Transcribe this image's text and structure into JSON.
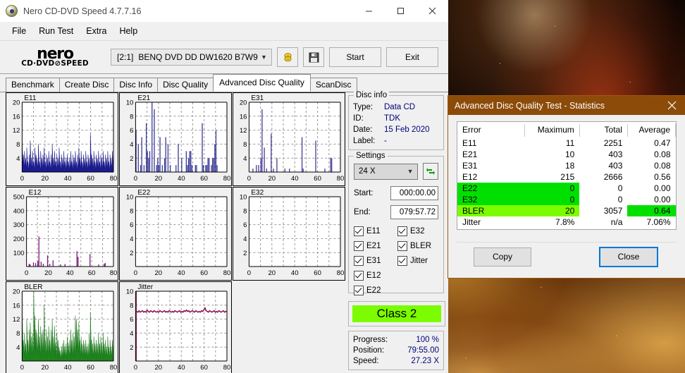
{
  "window": {
    "title": "Nero CD-DVD Speed 4.7.7.16",
    "icon": "nero-disc-icon",
    "minimize_label": "—",
    "maximize_label": "□",
    "close_label": "✕"
  },
  "menu": {
    "items": [
      "File",
      "Run Test",
      "Extra",
      "Help"
    ]
  },
  "toolbar": {
    "logo_line1": "nero",
    "logo_line2": "CD·DVD⊘SPEED",
    "drive_id": "[2:1]",
    "drive_name": "BENQ DVD DD DW1620 B7W9",
    "eject_icon": "disc-speed-icon",
    "save_icon": "floppy-save-icon",
    "start_label": "Start",
    "exit_label": "Exit"
  },
  "tabs": {
    "items": [
      "Benchmark",
      "Create Disc",
      "Disc Info",
      "Disc Quality",
      "Advanced Disc Quality",
      "ScanDisc"
    ],
    "active": "Advanced Disc Quality"
  },
  "disc_info": {
    "legend": "Disc info",
    "rows": [
      {
        "key": "Type:",
        "value": "Data CD"
      },
      {
        "key": "ID:",
        "value": "TDK"
      },
      {
        "key": "Date:",
        "value": "15 Feb 2020"
      },
      {
        "key": "Label:",
        "value": "-"
      }
    ]
  },
  "settings": {
    "legend": "Settings",
    "speed": "24 X",
    "refresh_icon": "refresh-icon",
    "start_label": "Start:",
    "start_value": "000:00.00",
    "end_label": "End:",
    "end_value": "079:57.72",
    "checkboxes_left": [
      "E11",
      "E21",
      "E31",
      "E12",
      "E22"
    ],
    "checkboxes_right": [
      "E32",
      "BLER",
      "Jitter"
    ]
  },
  "class_result": "Class 2",
  "class_color": "#7cfc00",
  "progress_panel": [
    {
      "key": "Progress:",
      "value": "100 %"
    },
    {
      "key": "Position:",
      "value": "79:55.00"
    },
    {
      "key": "Speed:",
      "value": "27.23 X"
    }
  ],
  "stats_dialog": {
    "title": "Advanced Disc Quality Test - Statistics",
    "close_icon": "close-icon",
    "headers": [
      "Error",
      "Maximum",
      "Total",
      "Average"
    ],
    "rows": [
      {
        "error": "E11",
        "maximum": "11",
        "total": "2251",
        "average": "0.47",
        "hl": "none"
      },
      {
        "error": "E21",
        "maximum": "10",
        "total": "403",
        "average": "0.08",
        "hl": "none"
      },
      {
        "error": "E31",
        "maximum": "18",
        "total": "403",
        "average": "0.08",
        "hl": "none"
      },
      {
        "error": "E12",
        "maximum": "215",
        "total": "2666",
        "average": "0.56",
        "hl": "none"
      },
      {
        "error": "E22",
        "maximum": "0",
        "total": "0",
        "average": "0.00",
        "hl": "green-left"
      },
      {
        "error": "E32",
        "maximum": "0",
        "total": "0",
        "average": "0.00",
        "hl": "green-left"
      },
      {
        "error": "BLER",
        "maximum": "20",
        "total": "3057",
        "average": "0.64",
        "hl": "lime-left-green-avg"
      },
      {
        "error": "Jitter",
        "maximum": "7.8%",
        "total": "n/a",
        "average": "7.06%",
        "hl": "none"
      }
    ],
    "copy_label": "Copy",
    "close_label": "Close"
  },
  "chart_data": [
    {
      "type": "area",
      "name": "E11",
      "title": "E11",
      "color": "#1a1a8c",
      "fill": "#1c1c90",
      "xlabel": "",
      "ylabel": "",
      "xlim": [
        0,
        80
      ],
      "ylim": [
        0,
        20
      ],
      "xticks": [
        0,
        20,
        40,
        60,
        80
      ],
      "yticks": [
        4,
        8,
        12,
        16,
        20
      ],
      "grid": true,
      "values": [
        8,
        5,
        6,
        4,
        7,
        3,
        5,
        9,
        4,
        6,
        3,
        7,
        5,
        4,
        8,
        3,
        6,
        4,
        5,
        7,
        3,
        5,
        4,
        6,
        3,
        5,
        8,
        4,
        6,
        3,
        5,
        4,
        7,
        3,
        5,
        4,
        6,
        3,
        4,
        5,
        3,
        4,
        6,
        3,
        5,
        4,
        6,
        3,
        5,
        7,
        4,
        6,
        3,
        5,
        4,
        6,
        3,
        5,
        4,
        11,
        5,
        4,
        6,
        3,
        5,
        4,
        6,
        3,
        5,
        4,
        6,
        3,
        5,
        4,
        6,
        3,
        5,
        4,
        6,
        4
      ]
    },
    {
      "type": "bar",
      "name": "E21",
      "title": "E21",
      "color": "#3a3a96",
      "xlabel": "",
      "ylabel": "",
      "xlim": [
        0,
        80
      ],
      "ylim": [
        0,
        10
      ],
      "xticks": [
        0,
        20,
        40,
        60,
        80
      ],
      "yticks": [
        2,
        4,
        6,
        8,
        10
      ],
      "grid": true,
      "values": [
        6,
        0,
        4,
        0,
        1,
        5,
        0,
        1,
        0,
        7,
        3,
        2,
        3,
        0,
        10,
        0,
        9,
        0,
        1,
        2,
        1,
        5,
        0,
        1,
        0,
        2,
        5,
        0,
        4,
        0,
        1,
        0,
        0,
        0,
        0,
        1,
        0,
        4,
        0,
        0,
        2,
        0,
        0,
        0,
        3,
        1,
        2,
        3,
        3,
        1,
        0,
        0,
        1,
        1,
        0,
        0,
        0,
        0,
        7,
        1,
        0,
        1,
        1,
        2,
        2,
        0,
        1,
        2,
        2,
        4,
        6,
        1,
        0,
        0,
        0,
        0,
        0,
        0,
        0,
        0
      ]
    },
    {
      "type": "bar",
      "name": "E31",
      "title": "E31",
      "color": "#4a3a96",
      "xlabel": "",
      "ylabel": "",
      "xlim": [
        0,
        80
      ],
      "ylim": [
        0,
        20
      ],
      "xticks": [
        0,
        20,
        40,
        60,
        80
      ],
      "yticks": [
        4,
        8,
        12,
        16,
        20
      ],
      "grid": true,
      "values": [
        0,
        0,
        0,
        1,
        0,
        0,
        2,
        0,
        2,
        0,
        4,
        18,
        0,
        7,
        0,
        1,
        0,
        0,
        0,
        11,
        0,
        1,
        0,
        0,
        4,
        0,
        0,
        0,
        0,
        0,
        0,
        1,
        0,
        0,
        0,
        1,
        0,
        0,
        0,
        0,
        0,
        0,
        0,
        0,
        0,
        0,
        10,
        1,
        0,
        0,
        0,
        0,
        0,
        0,
        0,
        0,
        0,
        0,
        9,
        0,
        0,
        0,
        0,
        0,
        0,
        0,
        1,
        0,
        0,
        0,
        0,
        4,
        4,
        0,
        0,
        0,
        0,
        0,
        0,
        0
      ]
    },
    {
      "type": "bar",
      "name": "E12",
      "title": "E12",
      "color": "#7a1b7a",
      "xlabel": "",
      "ylabel": "",
      "xlim": [
        0,
        80
      ],
      "ylim": [
        0,
        500
      ],
      "xticks": [
        0,
        20,
        40,
        60,
        80
      ],
      "yticks": [
        100,
        200,
        300,
        400,
        500
      ],
      "grid": true,
      "values": [
        0,
        0,
        20,
        15,
        0,
        0,
        30,
        0,
        25,
        0,
        40,
        215,
        0,
        35,
        0,
        20,
        0,
        0,
        0,
        80,
        0,
        20,
        0,
        0,
        45,
        0,
        0,
        0,
        0,
        0,
        0,
        15,
        0,
        0,
        0,
        18,
        0,
        0,
        0,
        0,
        0,
        0,
        0,
        0,
        0,
        0,
        110,
        70,
        0,
        0,
        0,
        0,
        0,
        0,
        0,
        0,
        0,
        0,
        90,
        0,
        0,
        0,
        0,
        0,
        0,
        0,
        15,
        0,
        0,
        0,
        0,
        20,
        25,
        0,
        0,
        0,
        0,
        0,
        0,
        0
      ]
    },
    {
      "type": "bar",
      "name": "E22",
      "title": "E22",
      "color": "#3a3a96",
      "xlabel": "",
      "ylabel": "",
      "xlim": [
        0,
        80
      ],
      "ylim": [
        0,
        10
      ],
      "xticks": [
        0,
        20,
        40,
        60,
        80
      ],
      "yticks": [
        2,
        4,
        6,
        8,
        10
      ],
      "grid": true,
      "values": []
    },
    {
      "type": "bar",
      "name": "E32",
      "title": "E32",
      "color": "#3a3a96",
      "xlabel": "",
      "ylabel": "",
      "xlim": [
        0,
        80
      ],
      "ylim": [
        0,
        10
      ],
      "xticks": [
        0,
        20,
        40,
        60,
        80
      ],
      "yticks": [
        2,
        4,
        6,
        8,
        10
      ],
      "grid": true,
      "values": []
    },
    {
      "type": "area",
      "name": "BLER",
      "title": "BLER",
      "color": "#1d7a1d",
      "fill": "#1d8c1d",
      "xlabel": "",
      "ylabel": "",
      "xlim": [
        0,
        80
      ],
      "ylim": [
        0,
        20
      ],
      "xticks": [
        0,
        20,
        40,
        60,
        80
      ],
      "yticks": [
        4,
        8,
        12,
        16,
        20
      ],
      "grid": true,
      "values": [
        14,
        6,
        8,
        5,
        12,
        6,
        9,
        11,
        7,
        8,
        20,
        13,
        9,
        8,
        12,
        7,
        10,
        8,
        9,
        16,
        6,
        9,
        7,
        10,
        6,
        9,
        12,
        7,
        10,
        5,
        8,
        6,
        4,
        3,
        4,
        5,
        6,
        4,
        5,
        7,
        5,
        6,
        9,
        6,
        8,
        7,
        13,
        12,
        9,
        11,
        6,
        7,
        5,
        6,
        5,
        6,
        4,
        5,
        8,
        14,
        6,
        5,
        7,
        5,
        6,
        5,
        8,
        5,
        7,
        5,
        8,
        5,
        6,
        4,
        7,
        4,
        6,
        4,
        6,
        6
      ]
    },
    {
      "type": "line",
      "name": "Jitter",
      "title": "Jitter",
      "color": "#8c1b55",
      "xlabel": "",
      "ylabel": "",
      "xlim": [
        0,
        80
      ],
      "ylim": [
        0,
        10
      ],
      "xticks": [
        0,
        20,
        40,
        60,
        80
      ],
      "yticks": [
        2,
        4,
        6,
        8,
        10
      ],
      "grid": true,
      "values": [
        7.0,
        7.1,
        7.0,
        7.2,
        7.0,
        7.1,
        7.2,
        7.0,
        7.1,
        7.0,
        7.3,
        7.1,
        7.0,
        7.2,
        7.1,
        7.0,
        7.2,
        7.1,
        7.0,
        7.1,
        7.0,
        7.2,
        7.1,
        7.0,
        7.1,
        7.2,
        7.0,
        7.1,
        7.0,
        7.2,
        7.1,
        7.0,
        7.1,
        7.0,
        7.2,
        7.1,
        7.0,
        7.1,
        7.2,
        7.0,
        7.1,
        7.0,
        7.2,
        7.1,
        7.3,
        7.1,
        7.2,
        7.0,
        7.1,
        7.2,
        7.1,
        7.0,
        7.2,
        7.1,
        7.0,
        7.1,
        7.0,
        7.2,
        7.1,
        7.3,
        7.6,
        7.2,
        7.1,
        7.0,
        7.2,
        7.1,
        7.0,
        7.1,
        7.2,
        7.0,
        7.1,
        7.0,
        7.2,
        7.1,
        7.0,
        7.1,
        7.2,
        7.0,
        7.1,
        7.1
      ]
    }
  ]
}
